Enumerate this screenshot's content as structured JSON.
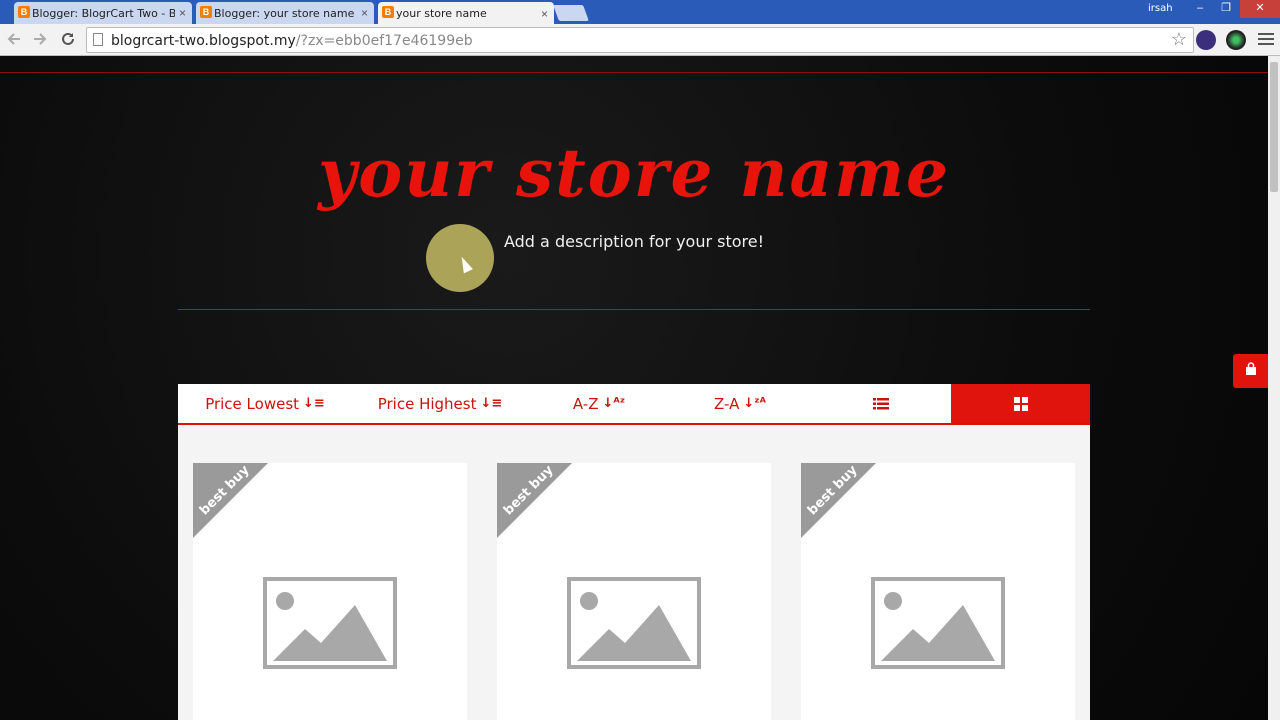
{
  "browser": {
    "tabs": [
      {
        "title": "Blogger: BlogrCart Two - B",
        "favicon": "B"
      },
      {
        "title": "Blogger: your store name",
        "favicon": "B"
      },
      {
        "title": "your store name",
        "favicon": "B"
      }
    ],
    "close_glyph": "×",
    "user": "irsah",
    "window_controls": {
      "minimize": "–",
      "maximize": "❐",
      "close": "✕"
    },
    "url_host": "blogrcart-two.blogspot.my",
    "url_rest": "/?zx=ebb0ef17e46199eb"
  },
  "store": {
    "name": "your store name",
    "description": "Add a description for your store!"
  },
  "sortbar": {
    "price_lowest": "Price Lowest",
    "price_highest": "Price Highest",
    "a_z": "A-Z",
    "z_a": "Z-A",
    "list_icon": "list-icon",
    "grid_icon": "grid-icon"
  },
  "cards": [
    {
      "ribbon": "best buy"
    },
    {
      "ribbon": "best buy"
    },
    {
      "ribbon": "best buy"
    }
  ],
  "colors": {
    "accent": "#e0140c",
    "ribbon": "#9a9a9a",
    "placeholder": "#a8a8a8"
  }
}
